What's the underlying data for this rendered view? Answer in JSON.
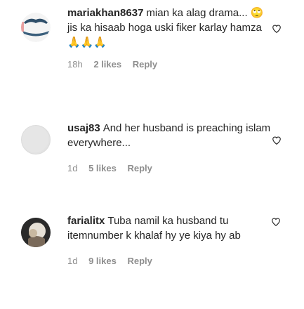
{
  "comments": [
    {
      "username": "mariakhan8637",
      "text_a": "mian ka alag drama... ",
      "emoji_a": "🙄",
      "text_b": " jis ka hisaab hoga uski fiker karlay hamza",
      "emoji_b": "🙏🙏🙏",
      "time": "18h",
      "likes": "2 likes",
      "reply": "Reply"
    },
    {
      "username": "usaj83",
      "text": "And her husband is preaching islam everywhere...",
      "time": "1d",
      "likes": "5 likes",
      "reply": "Reply"
    },
    {
      "username": "farialitx",
      "text": "Tuba namil ka husband tu itemnumber k khalaf hy ye kiya hy ab",
      "time": "1d",
      "likes": "9 likes",
      "reply": "Reply"
    }
  ],
  "icons": {
    "avatar": "avatar-icon",
    "like": "heart-outline-icon"
  },
  "colors": {
    "text": "#262626",
    "meta": "#8e8e8e",
    "border": "#dcdcdc"
  }
}
